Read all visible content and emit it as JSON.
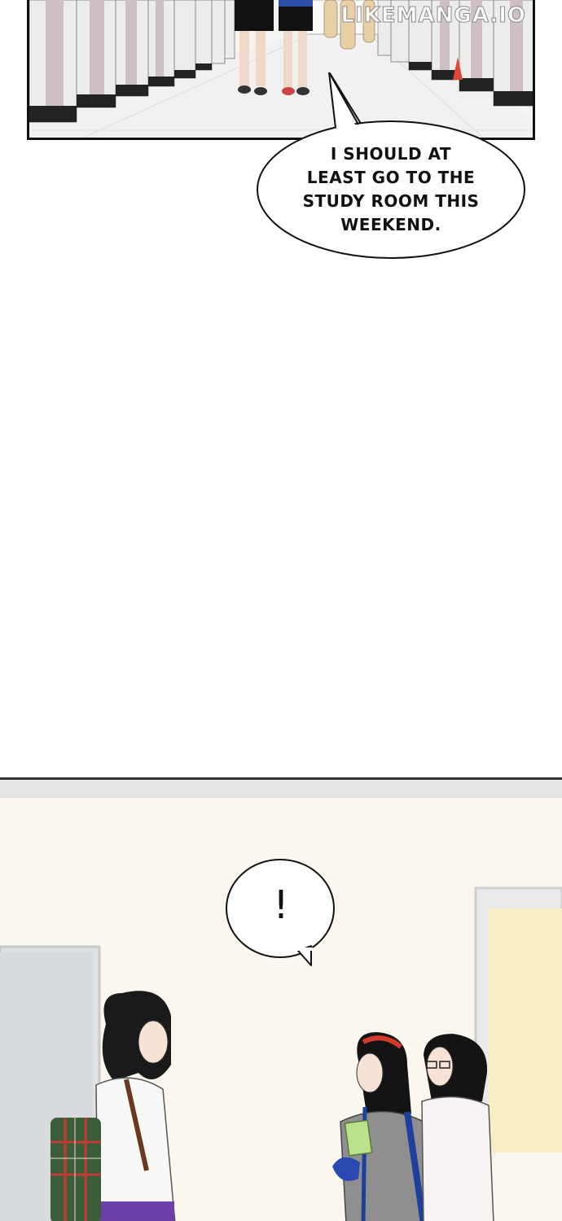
{
  "watermark": "LIKEMANGA.IO",
  "panel_top": {
    "speech_bubble": "I SHOULD AT LEAST GO TO THE STUDY ROOM THIS WEEKEND.",
    "speech_lines": [
      "I SHOULD AT",
      "LEAST GO TO THE",
      "STUDY ROOM THIS",
      "WEEKEND."
    ]
  },
  "panel_bottom": {
    "speech_bubble": "!"
  },
  "colors": {
    "panel_border": "#111111",
    "wall": "#fbf6ee",
    "hallway_floor": "#f2f2f2",
    "window_glow": "#fbedc3"
  }
}
